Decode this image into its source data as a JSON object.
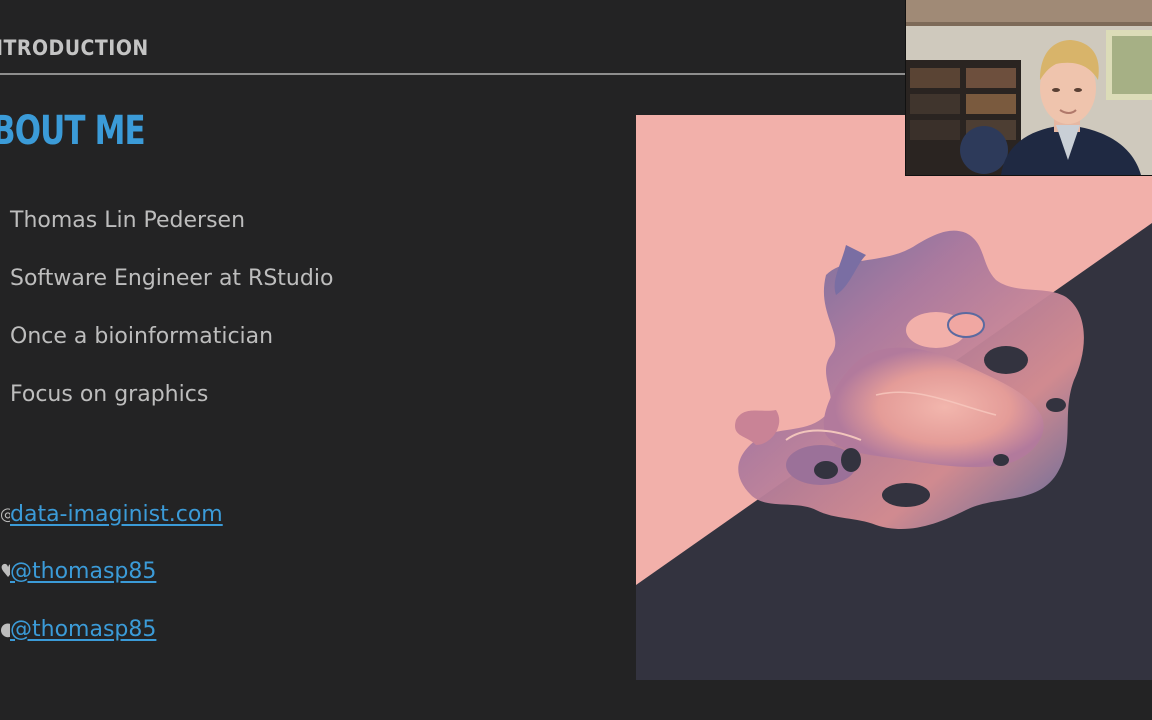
{
  "slide": {
    "section": "ITRODUCTION",
    "title": "BOUT ME",
    "bullets": [
      "Thomas Lin Pedersen",
      "Software Engineer at RStudio",
      "Once a bioinformatician",
      "Focus on graphics"
    ],
    "links": [
      {
        "icon": "globe-icon",
        "glyph": "◎",
        "text": "data-imaginist.com"
      },
      {
        "icon": "twitter-icon",
        "glyph": "♥",
        "text": "@thomasp85"
      },
      {
        "icon": "github-icon",
        "glyph": "●",
        "text": "@thomasp85"
      }
    ]
  },
  "colors": {
    "background": "#232324",
    "accent": "#3b9bd8",
    "text": "#bdbdbd",
    "art_pink": "#f2b0aa",
    "art_dark": "#33333f",
    "art_purple": "#5b6aa0"
  }
}
